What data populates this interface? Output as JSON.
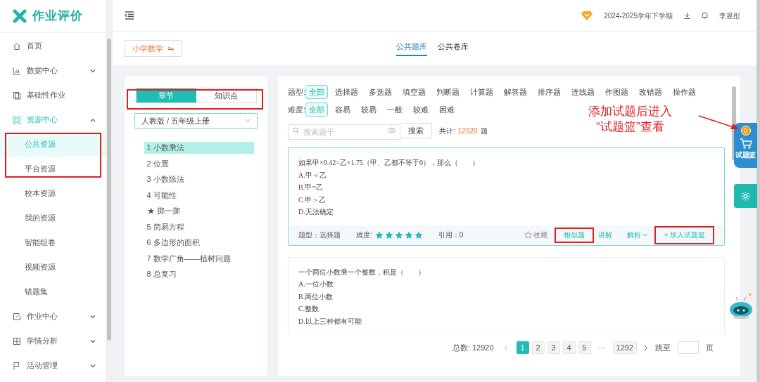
{
  "app": {
    "title": "作业评价"
  },
  "sidebar": {
    "items": [
      {
        "label": "首页",
        "selected": false
      },
      {
        "label": "数据中心",
        "expanded": false,
        "selected": false
      },
      {
        "label": "基础性作业",
        "selected": false
      },
      {
        "label": "资源中心",
        "expanded": true,
        "selected": true,
        "children": [
          {
            "label": "公共资源",
            "selected": true
          },
          {
            "label": "平台资源",
            "selected": false
          },
          {
            "label": "校本资源",
            "selected": false
          },
          {
            "label": "我的资源",
            "selected": false
          },
          {
            "label": "智能组卷",
            "selected": false
          },
          {
            "label": "视频资源",
            "selected": false
          },
          {
            "label": "错题集",
            "selected": false
          }
        ]
      },
      {
        "label": "作业中心",
        "expanded": false,
        "selected": false
      },
      {
        "label": "学情分析",
        "expanded": false,
        "selected": false
      },
      {
        "label": "活动管理",
        "expanded": false,
        "selected": false
      }
    ]
  },
  "header": {
    "term": "2024-2025学年下学期",
    "user": "李昱彤"
  },
  "subject_button": {
    "label": "小学数学",
    "icon_char": "⇋"
  },
  "library_tabs": [
    {
      "label": "公共题库",
      "selected": true
    },
    {
      "label": "公共卷库",
      "selected": false
    }
  ],
  "left_panel": {
    "tabs": [
      {
        "label": "章节",
        "selected": true
      },
      {
        "label": "知识点",
        "selected": false
      }
    ],
    "edition_select": {
      "value": "人教版 / 五年级上册"
    },
    "chapters": [
      {
        "label": "1 小数乘法",
        "selected": true
      },
      {
        "label": "2 位置",
        "selected": false
      },
      {
        "label": "3 小数除法",
        "selected": false
      },
      {
        "label": "4 可能性",
        "selected": false
      },
      {
        "label": "★ 掷一掷",
        "selected": false
      },
      {
        "label": "5 简易方程",
        "selected": false
      },
      {
        "label": "6 多边形的面积",
        "selected": false
      },
      {
        "label": "7 数学广角——植树问题",
        "selected": false
      },
      {
        "label": "8 总复习",
        "selected": false
      }
    ]
  },
  "filters": [
    {
      "label": "题型:",
      "options": [
        {
          "label": "全部",
          "selected": true
        },
        {
          "label": "选择题",
          "selected": false
        },
        {
          "label": "多选题",
          "selected": false
        },
        {
          "label": "填空题",
          "selected": false
        },
        {
          "label": "判断题",
          "selected": false
        },
        {
          "label": "计算题",
          "selected": false
        },
        {
          "label": "解答题",
          "selected": false
        },
        {
          "label": "排序题",
          "selected": false
        },
        {
          "label": "连线题",
          "selected": false
        },
        {
          "label": "作图题",
          "selected": false
        },
        {
          "label": "改错题",
          "selected": false
        },
        {
          "label": "操作题",
          "selected": false
        }
      ]
    },
    {
      "label": "难度:",
      "options": [
        {
          "label": "全部",
          "selected": true
        },
        {
          "label": "容易",
          "selected": false
        },
        {
          "label": "较易",
          "selected": false
        },
        {
          "label": "一般",
          "selected": false
        },
        {
          "label": "较难",
          "selected": false
        },
        {
          "label": "困难",
          "selected": false
        }
      ]
    }
  ],
  "search": {
    "placeholder": "搜索题干",
    "button": "搜索",
    "total_label": "共计:",
    "total": "12920",
    "total_unit": "题"
  },
  "questions": [
    {
      "stem": "如果甲×0.42=乙×1.75（甲、乙都不等于0），那么（　　）",
      "options": [
        "A.甲＜乙",
        "B.甲=乙",
        "C.甲＞乙",
        "D.无法确定"
      ],
      "highlighted": true,
      "footer": {
        "type_label": "题型：选择题",
        "difficulty_label": "难度:",
        "stars": 5,
        "cite": "引用：0",
        "favorite": "收藏",
        "similar": "相似题",
        "explain": "讲解",
        "analysis": "解析",
        "add": "+ 加入试题篮"
      }
    },
    {
      "stem": "一个两位小数乘一个整数，积是（　　）",
      "options": [
        "A.一位小数",
        "B.两位小数",
        "C.整数",
        "D.以上三种都有可能"
      ],
      "highlighted": false
    }
  ],
  "pagination": {
    "total": "总数: 12920",
    "pages": [
      {
        "label": "1",
        "selected": true
      },
      {
        "label": "2",
        "selected": false
      },
      {
        "label": "3",
        "selected": false
      },
      {
        "label": "4",
        "selected": false
      },
      {
        "label": "5",
        "selected": false
      }
    ],
    "ellipsis": "···",
    "last": "1292",
    "jump_label": "跳至",
    "page_unit": "页"
  },
  "basket": {
    "count": "0",
    "label": "试题篮"
  },
  "annotation": {
    "lines": [
      "添加试题后进入",
      "“试题篮”查看"
    ]
  }
}
